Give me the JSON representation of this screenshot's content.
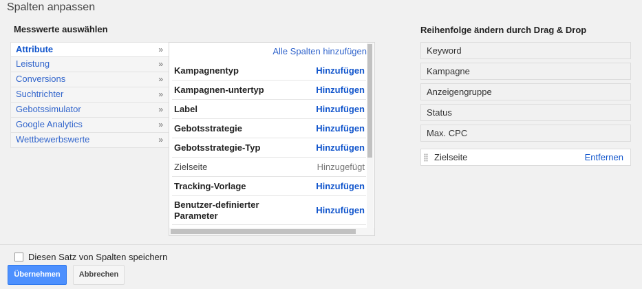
{
  "dialog": {
    "title": "Spalten anpassen"
  },
  "left": {
    "heading": "Messwerte auswählen",
    "categories": [
      {
        "label": "Attribute",
        "chevron": "»"
      },
      {
        "label": "Leistung",
        "chevron": "»"
      },
      {
        "label": "Conversions",
        "chevron": "»"
      },
      {
        "label": "Suchtrichter",
        "chevron": "»"
      },
      {
        "label": "Gebotssimulator",
        "chevron": "»"
      },
      {
        "label": "Google Analytics",
        "chevron": "»"
      },
      {
        "label": "Wettbewerbswerte",
        "chevron": "»"
      }
    ]
  },
  "metrics": {
    "add_all": "Alle Spalten hinzufügen",
    "rows": [
      {
        "label": "Kampagnentyp",
        "action": "Hinzufügen"
      },
      {
        "label": "Kampagnen-untertyp",
        "action": "Hinzufügen"
      },
      {
        "label": "Label",
        "action": "Hinzufügen"
      },
      {
        "label": "Gebotsstrategie",
        "action": "Hinzufügen"
      },
      {
        "label": "Gebotsstrategie-Typ",
        "action": "Hinzufügen"
      },
      {
        "label": "Zielseite",
        "action": "Hinzugefügt"
      },
      {
        "label": "Tracking-Vorlage",
        "action": "Hinzufügen"
      },
      {
        "label": "Benutzer-definierter Parameter",
        "action": "Hinzufügen"
      }
    ]
  },
  "right": {
    "heading": "Reihenfolge ändern durch Drag & Drop",
    "fixed_columns": [
      "Keyword",
      "Kampagne",
      "Anzeigengruppe",
      "Status",
      "Max. CPC"
    ],
    "custom_column": {
      "label": "Zielseite",
      "remove": "Entfernen"
    }
  },
  "footer": {
    "save_set_label": "Diesen Satz von Spalten speichern",
    "apply_button": "Übernehmen",
    "cancel_button": "Abbrechen"
  },
  "colors": {
    "link": "#1155cc",
    "primary_button": "#4d90fe"
  },
  "icons": {
    "chevron": "double-chevron-right-icon",
    "drag": "drag-handle-icon"
  }
}
